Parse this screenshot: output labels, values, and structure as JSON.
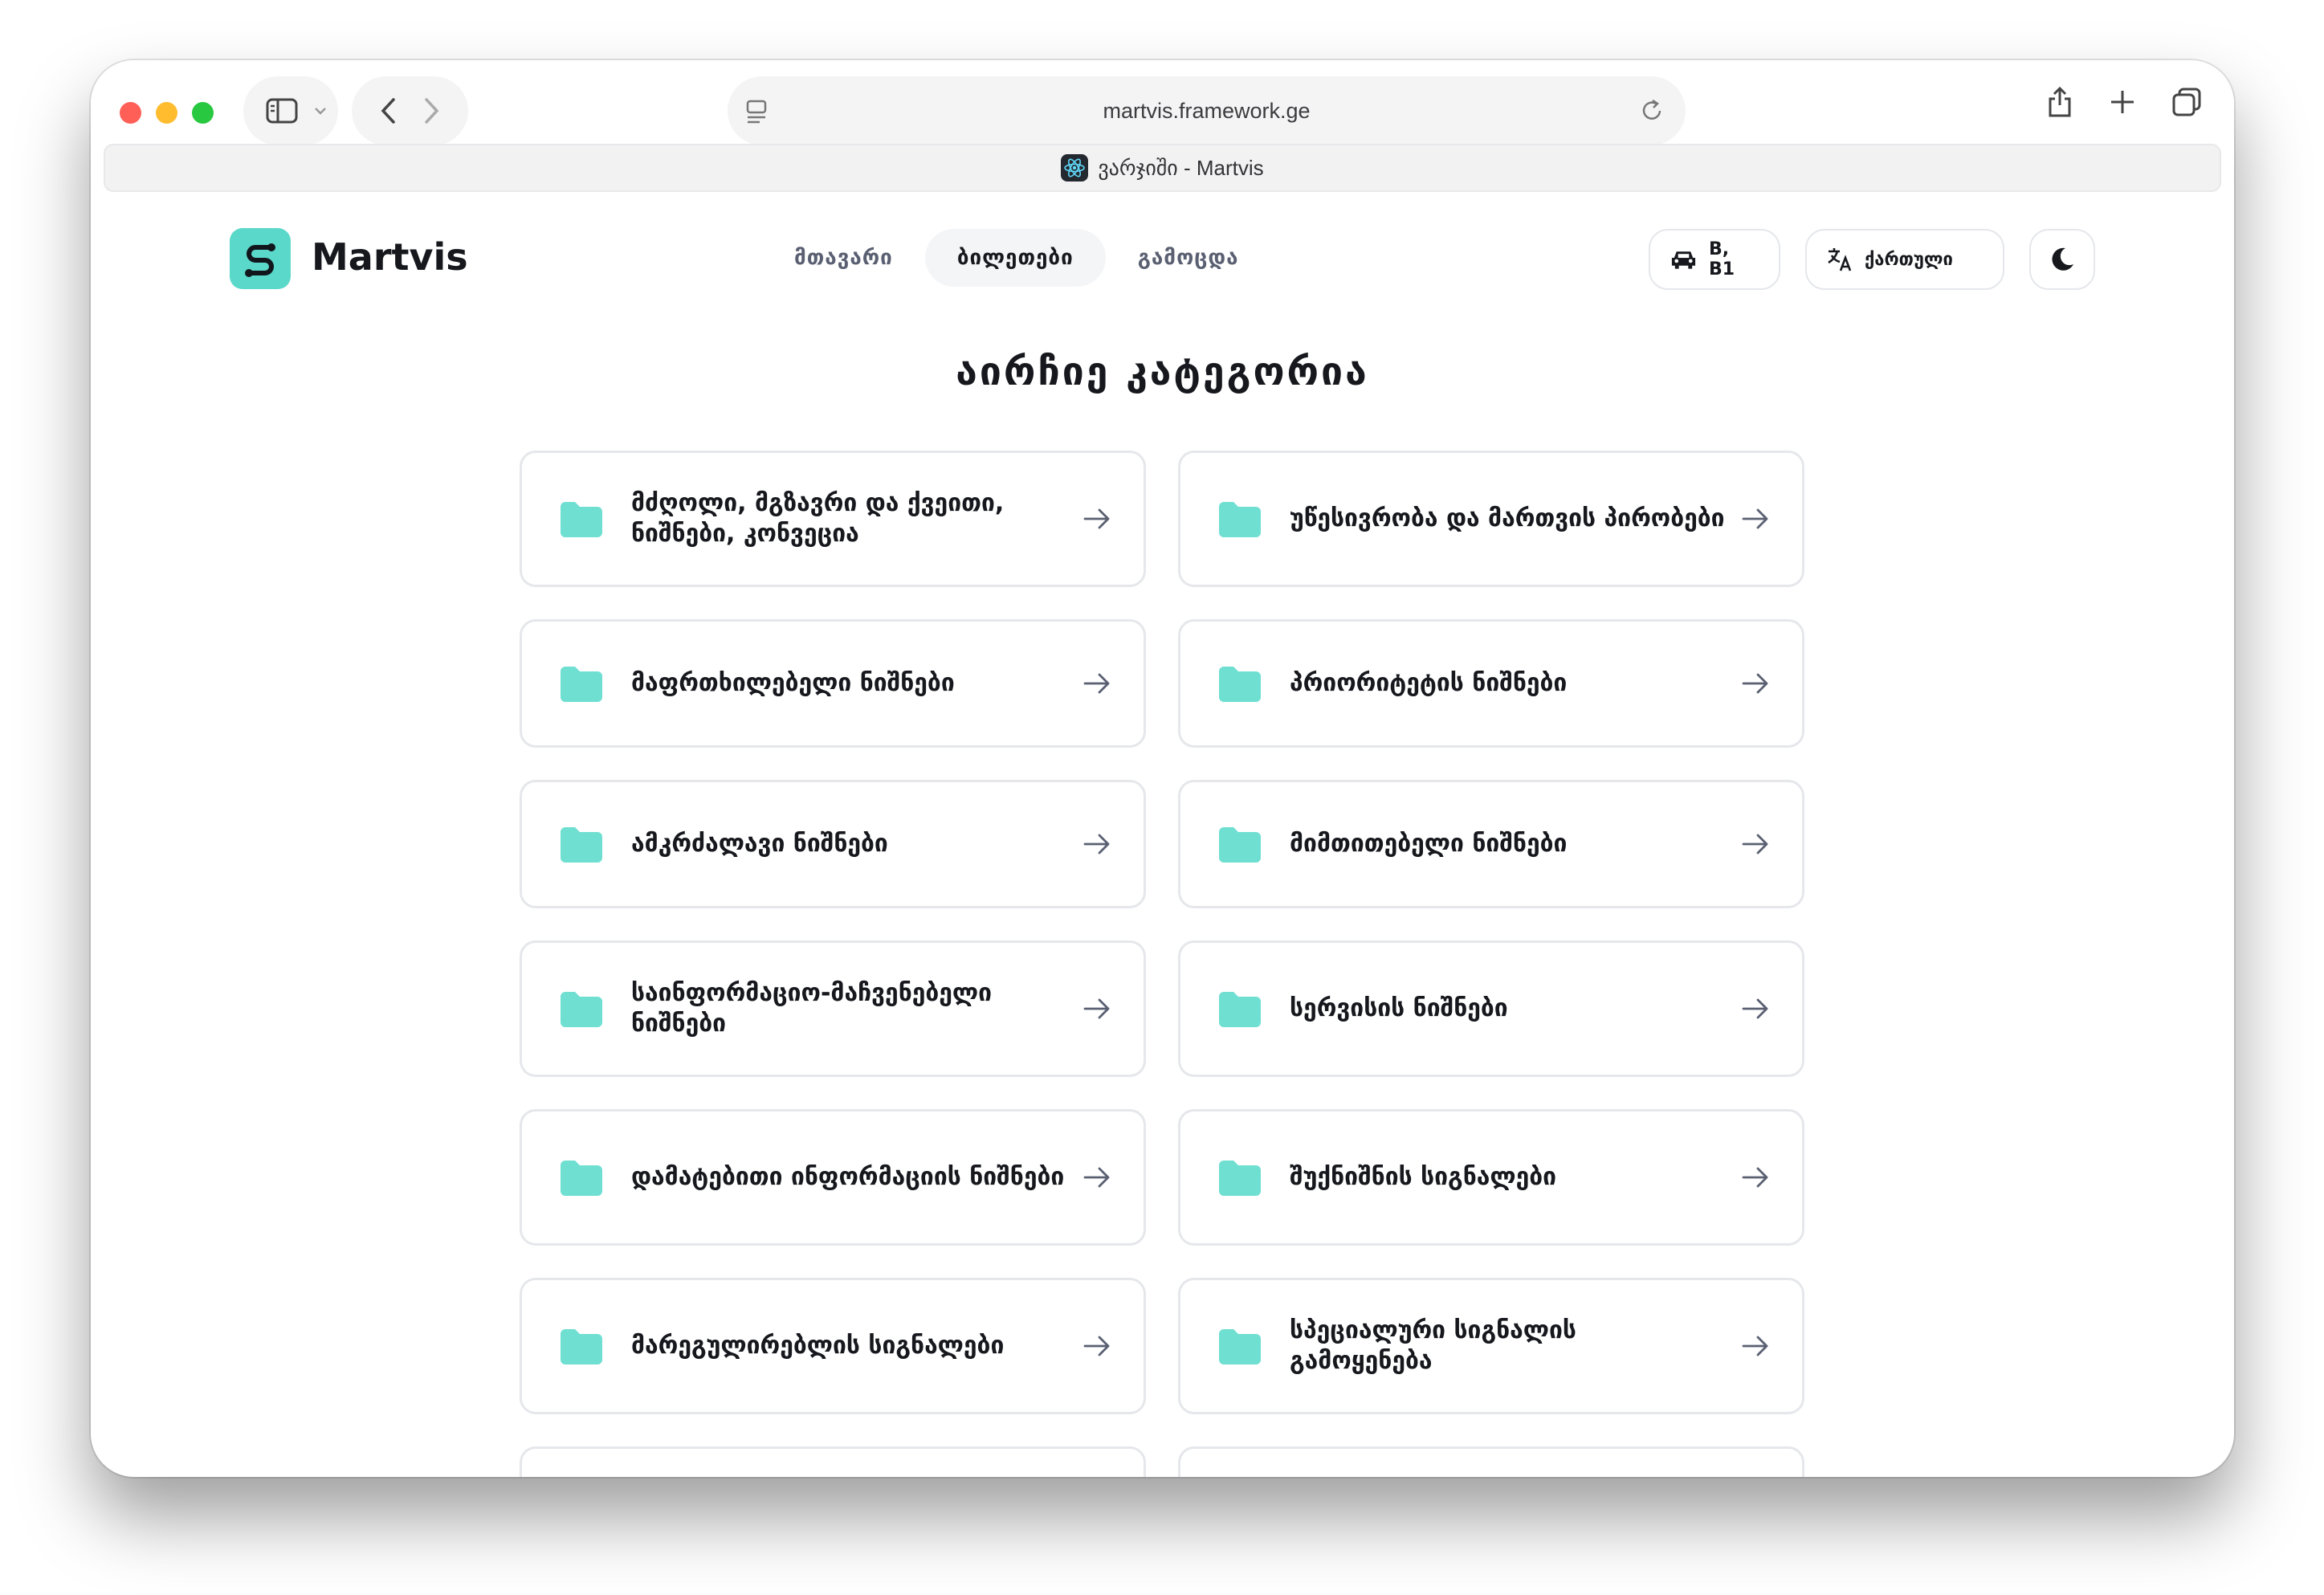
{
  "browser": {
    "url": "martvis.framework.ge",
    "tab_title": "ვარჯიში - Martvis"
  },
  "header": {
    "logo_text": "Martvis",
    "nav": [
      {
        "label": "მთავარი"
      },
      {
        "label": "ბილეთები"
      },
      {
        "label": "გამოცდა"
      }
    ],
    "license_label": "B, B1",
    "language_label": "ქართული"
  },
  "main": {
    "title": "აირჩიე კატეგორია",
    "categories": [
      {
        "label": "მძღოლი, მგზავრი და ქვეითი, ნიშნები, კონვეცია"
      },
      {
        "label": "უწესივრობა და მართვის პირობები"
      },
      {
        "label": "მაფრთხილებელი ნიშნები"
      },
      {
        "label": "პრიორიტეტის ნიშნები"
      },
      {
        "label": "ამკრძალავი ნიშნები"
      },
      {
        "label": "მიმთითებელი ნიშნები"
      },
      {
        "label": "საინფორმაციო-მაჩვენებელი ნიშნები"
      },
      {
        "label": "სერვისის ნიშნები"
      },
      {
        "label": "დამატებითი ინფორმაციის ნიშნები"
      },
      {
        "label": "შუქნიშნის სიგნალები"
      },
      {
        "label": "მარეგულირებლის სიგნალები"
      },
      {
        "label": "სპეციალური სიგნალის გამოყენება"
      }
    ]
  },
  "colors": {
    "accent": "#5ad8c9",
    "folder": "#6fdfd2",
    "text": "#16181d",
    "border": "#e5e7eb"
  }
}
